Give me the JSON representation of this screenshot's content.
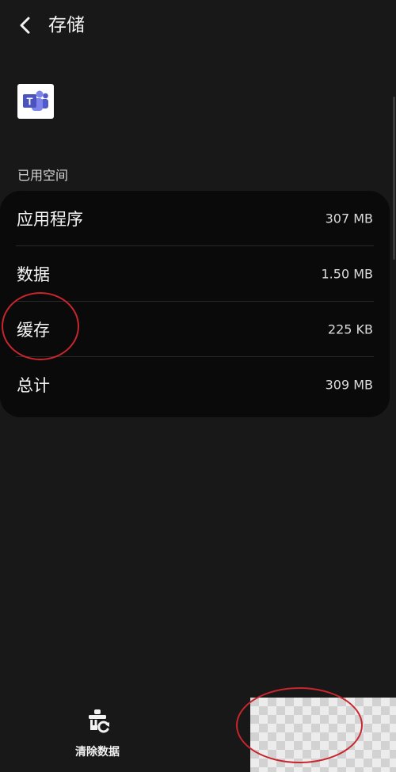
{
  "header": {
    "title": "存储",
    "back_icon": "chevron-left-icon"
  },
  "app": {
    "icon": "microsoft-teams-icon",
    "icon_letter": "T"
  },
  "storage": {
    "section_label": "已用空间",
    "rows": [
      {
        "label": "应用程序",
        "value": "307 MB"
      },
      {
        "label": "数据",
        "value": "1.50 MB"
      },
      {
        "label": "缓存",
        "value": "225 KB"
      },
      {
        "label": "总计",
        "value": "309 MB"
      }
    ]
  },
  "bottom_bar": {
    "clear_data_label": "清除数据",
    "clear_data_icon": "broom-clear-icon"
  },
  "colors": {
    "background": "#181818",
    "card": "#0a0a0a",
    "teams_accent": "#5b5fc7",
    "annotation": "#c9252c"
  }
}
